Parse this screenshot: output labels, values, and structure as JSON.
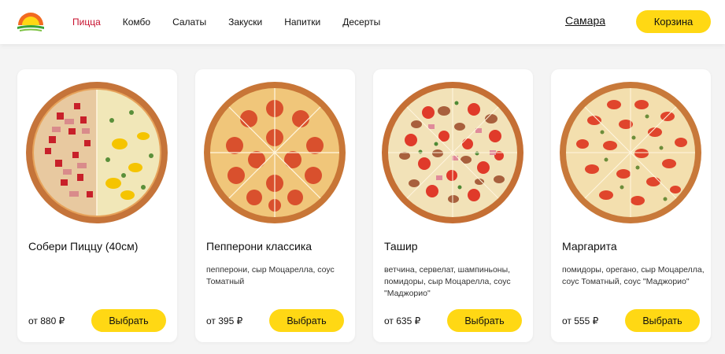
{
  "header": {
    "logo_icon": "sunrise-logo-icon",
    "nav": [
      "Пицца",
      "Комбо",
      "Салаты",
      "Закуски",
      "Напитки",
      "Десерты"
    ],
    "active_nav": "Пицца",
    "city": "Самара",
    "cart_label": "Корзина"
  },
  "colors": {
    "accent": "#ffd814",
    "active_nav": "#c8102e",
    "background": "#f4f4f4"
  },
  "products": [
    {
      "title": "Собери Пиццу (40см)",
      "description": "",
      "price": "от 880 ₽",
      "button": "Выбрать",
      "image_icon": "half-and-half-pizza-image"
    },
    {
      "title": "Пепперони классика",
      "description": "пепперони, сыр Моцарелла, соус Томатный",
      "price": "от 395 ₽",
      "button": "Выбрать",
      "image_icon": "pepperoni-pizza-image"
    },
    {
      "title": "Ташир",
      "description": "ветчина, сервелат, шампиньоны, помидоры, сыр Моцарелла, соус \"Маджорио\"",
      "price": "от 635 ₽",
      "button": "Выбрать",
      "image_icon": "tashir-pizza-image"
    },
    {
      "title": "Маргарита",
      "description": "помидоры, орегано, сыр Моцарелла, соус Томатный, соус \"Маджорио\"",
      "price": "от 555 ₽",
      "button": "Выбрать",
      "image_icon": "margarita-pizza-image"
    }
  ]
}
